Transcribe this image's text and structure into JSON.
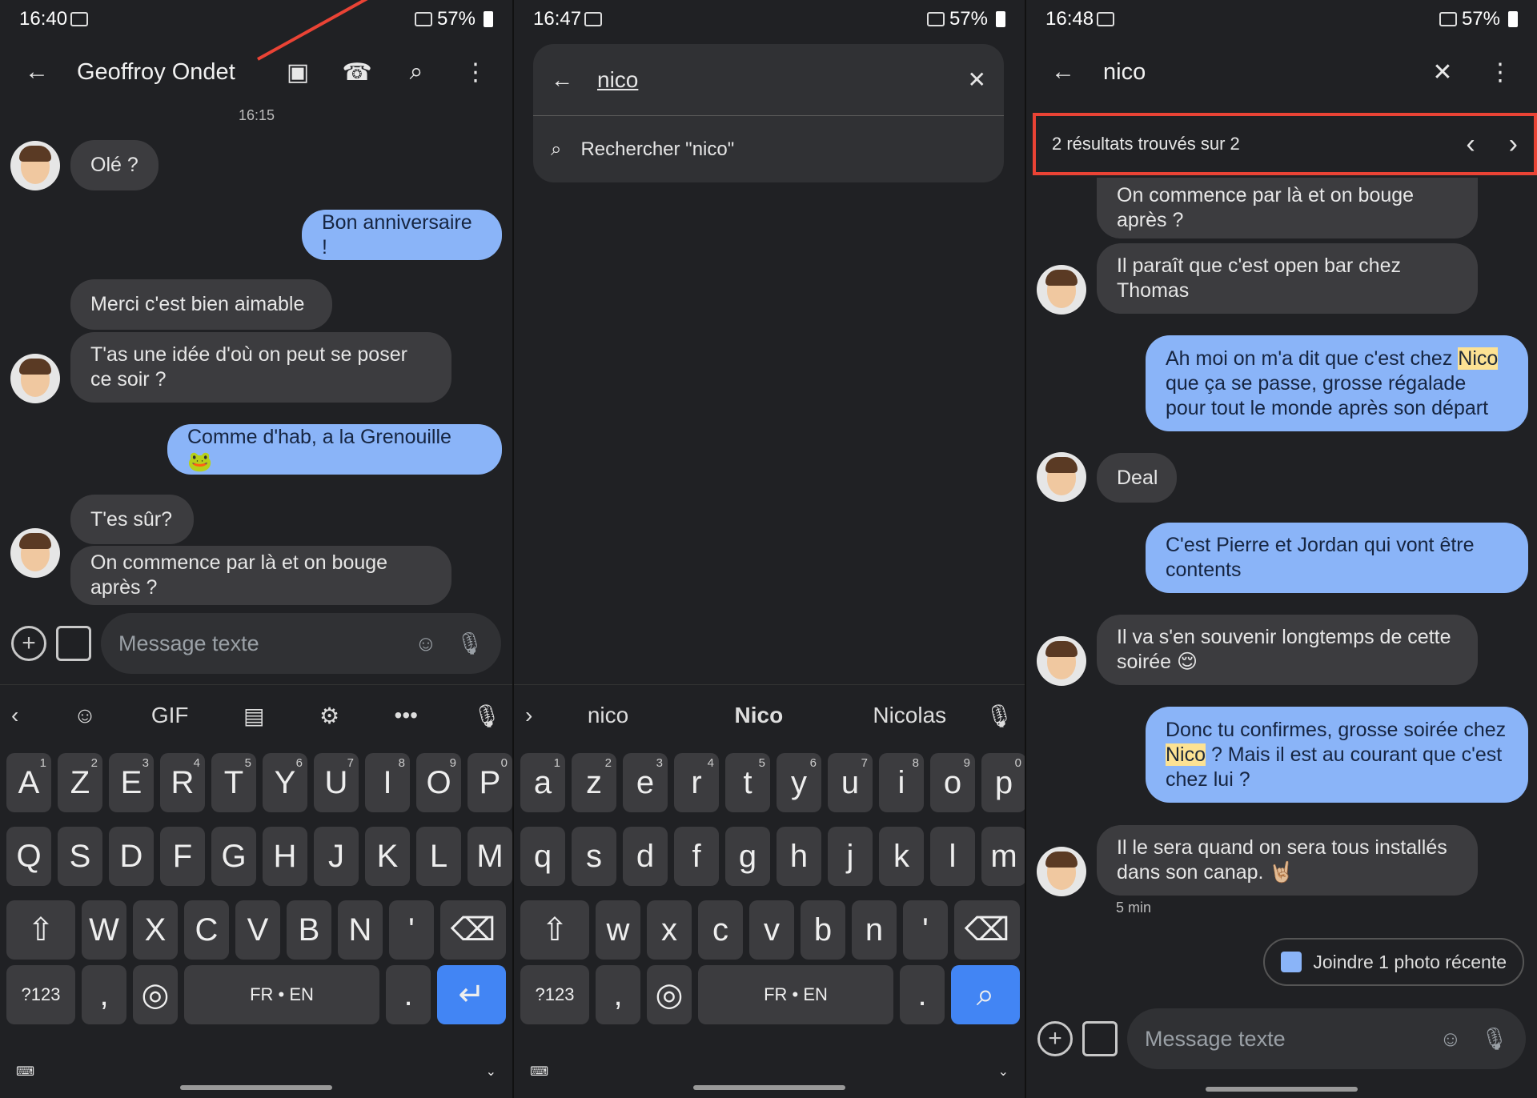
{
  "panel1": {
    "status": {
      "time": "16:40",
      "battery": "57%"
    },
    "header": {
      "contact": "Geoffroy Ondet"
    },
    "timestamp": "16:15",
    "messages": [
      "Olé ?",
      "Bon anniversaire !",
      "Merci c'est bien aimable",
      "T'as une idée d'où on peut se poser ce soir ?",
      "Comme d'hab, a la Grenouille 🐸",
      "T'es sûr?",
      "On commence par là et on bouge après ?"
    ],
    "composer": {
      "placeholder": "Message texte"
    },
    "keyboard": {
      "toolbar": [
        "GIF",
        "•••"
      ],
      "rows": [
        [
          "A",
          "Z",
          "E",
          "R",
          "T",
          "Y",
          "U",
          "I",
          "O",
          "P"
        ],
        [
          "Q",
          "S",
          "D",
          "F",
          "G",
          "H",
          "J",
          "K",
          "L",
          "M"
        ],
        [
          "W",
          "X",
          "C",
          "V",
          "B",
          "N",
          "'"
        ]
      ],
      "numbers": [
        "1",
        "2",
        "3",
        "4",
        "5",
        "6",
        "7",
        "8",
        "9",
        "0"
      ],
      "bottom": [
        "?123",
        ",",
        "FR • EN",
        "."
      ]
    }
  },
  "panel2": {
    "status": {
      "time": "16:47",
      "battery": "57%"
    },
    "search": {
      "query": "nico",
      "suggestion": "Rechercher \"nico\""
    },
    "keyboard": {
      "suggestions": [
        "nico",
        "Nico",
        "Nicolas"
      ],
      "rows": [
        [
          "a",
          "z",
          "e",
          "r",
          "t",
          "y",
          "u",
          "i",
          "o",
          "p"
        ],
        [
          "q",
          "s",
          "d",
          "f",
          "g",
          "h",
          "j",
          "k",
          "l",
          "m"
        ],
        [
          "w",
          "x",
          "c",
          "v",
          "b",
          "n",
          "'"
        ]
      ],
      "numbers": [
        "1",
        "2",
        "3",
        "4",
        "5",
        "6",
        "7",
        "8",
        "9",
        "0"
      ],
      "bottom": [
        "?123",
        ",",
        "FR • EN",
        "."
      ]
    }
  },
  "panel3": {
    "status": {
      "time": "16:48",
      "battery": "57%"
    },
    "search": {
      "query": "nico",
      "results": "2 résultats trouvés sur 2"
    },
    "messages": {
      "m1": "On commence par là et on bouge après ?",
      "m2": "Il paraît que c'est open bar chez Thomas",
      "m3a": "Ah moi on m'a dit que c'est chez ",
      "m3b": "Nico",
      "m3c": " que ça se passe, grosse régalade pour tout le monde après son départ",
      "m4": "Deal",
      "m5": "C'est Pierre et Jordan qui vont être contents",
      "m6": "Il va s'en souvenir longtemps de cette soirée 😌",
      "m7a": "Donc tu confirmes, grosse soirée chez ",
      "m7b": "Nico",
      "m7c": " ? Mais il est au courant que c'est chez lui ?",
      "m8": "Il le sera quand on sera tous installés dans son canap. 🤘🏼",
      "time": "5 min"
    },
    "chip": "Joindre 1 photo récente",
    "composer": {
      "placeholder": "Message texte"
    }
  },
  "colors": {
    "background": "#202124",
    "incoming": "#3c3c3f",
    "outgoing": "#8ab4f8",
    "accent": "#4285f4",
    "highlight": "#fde293",
    "annotation": "#ea4335"
  }
}
